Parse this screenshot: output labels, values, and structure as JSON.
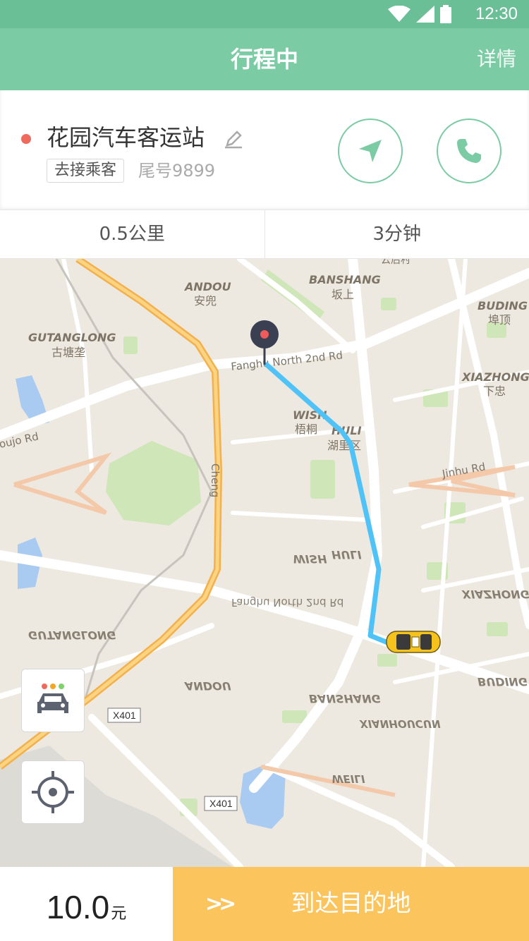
{
  "status_bar": {
    "time": "12:30"
  },
  "nav": {
    "title": "行程中",
    "detail": "详情"
  },
  "trip": {
    "station": "花园汽车客运站",
    "task": "去接乘客",
    "tail_number": "尾号9899"
  },
  "stats": {
    "distance": "0.5公里",
    "duration": "3分钟"
  },
  "map": {
    "labels": {
      "andou_en": "ANDOU",
      "andou_zh": "安兜",
      "banshang_en": "BANSHANG",
      "banshang_zh": "坂上",
      "buding_en": "BUDING",
      "buding_zh": "埠顶",
      "gutanglong_en": "GUTANGLONG",
      "gutanglong_zh": "古塘垄",
      "xiazhong_en": "XIAZHONG",
      "xiazhong_zh": "下忠",
      "wish_en": "WISH",
      "wish_zh": "梧桐",
      "huli_en": "HULI",
      "huli_zh": "湖里区",
      "road_fanghu": "Fanghu North 2nd Rd",
      "road_jinhu": "Jinhu Rd",
      "road_oujo": "oujo Rd",
      "road_cheng": "Cheng",
      "top_cut": "云后村",
      "x401": "X401"
    },
    "route_color": "#4fc3f7",
    "pin_color": "#3a3f52"
  },
  "fare": {
    "value": "10.0",
    "unit": "元"
  },
  "action": {
    "chevron": ">>",
    "label": "到达目的地"
  },
  "colors": {
    "header": "#7bcba4",
    "status": "#6bbf96",
    "action": "#fcc45c",
    "dot": "#ef6a5c"
  }
}
